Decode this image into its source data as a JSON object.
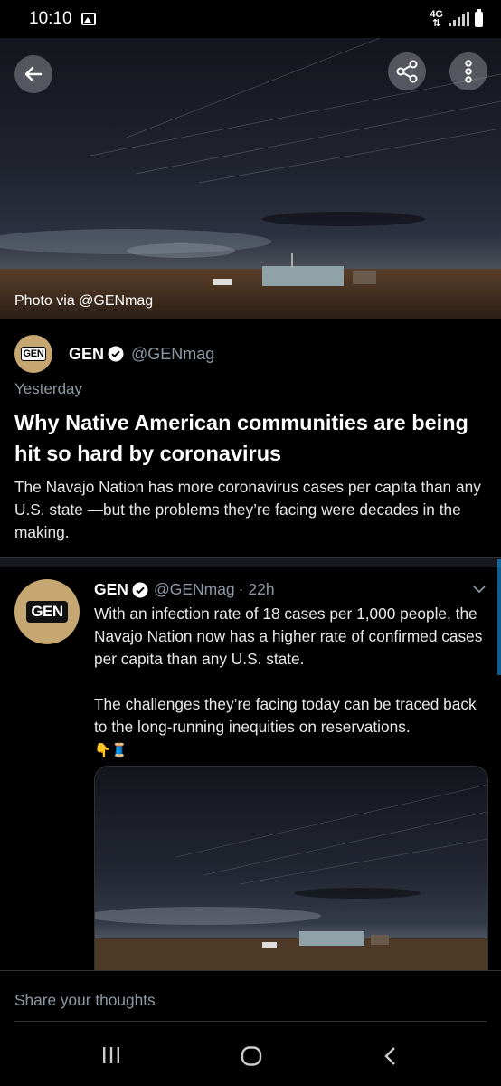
{
  "status_bar": {
    "time": "10:10",
    "icons": [
      "gallery-icon",
      "data-arrows-icon",
      "signal-icon",
      "battery-icon"
    ],
    "net_label": "4G"
  },
  "hero": {
    "photo_credit": "Photo via @GENmag",
    "buttons": [
      "back-arrow-icon",
      "share-icon",
      "more-vertical-icon"
    ]
  },
  "article": {
    "author": "GEN",
    "handle": "@GENmag",
    "logo_text": "GEN",
    "date": "Yesterday",
    "headline": "Why Native American communities are being hit so hard by coronavirus",
    "summary": "The Navajo Nation has more coronavirus cases per capita than any U.S. state —but the problems they’re facing were decades in the making."
  },
  "tweet": {
    "author": "GEN",
    "handle": "@GENmag",
    "time": "· 22h",
    "avatar_text": "GEN",
    "text": "With an infection rate of 18 cases per 1,000 people, the Navajo Nation now has a higher rate of confirmed cases per capita than any U.S. state.\n\nThe challenges they’re facing today can be traced back to the long-running inequities on reservations.",
    "emojis": "👇🧵"
  },
  "composer": {
    "placeholder": "Share your thoughts"
  },
  "nav": [
    "recent-apps-icon",
    "home-icon",
    "back-icon"
  ],
  "colors": {
    "accent": "#1d9bf0",
    "logo_gold": "#c6a772",
    "secondary_text": "#8b98a5"
  }
}
